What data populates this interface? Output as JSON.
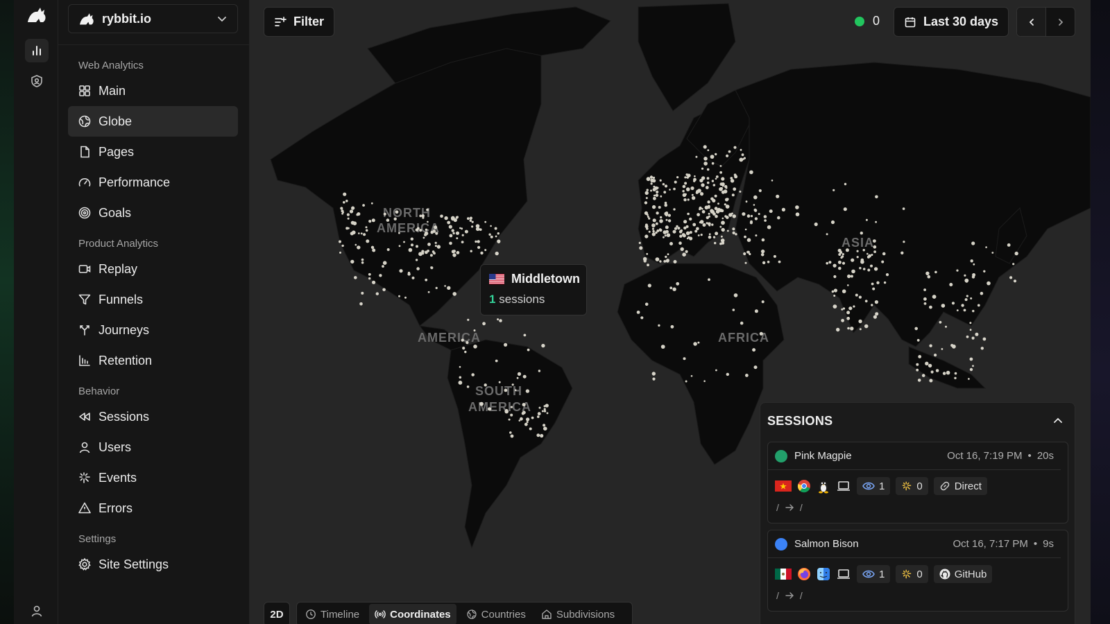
{
  "app": {
    "site_name": "rybbit.io"
  },
  "rail": {
    "icons": [
      "rybbit-logo-icon",
      "analytics-bar-chart-icon",
      "shield-user-icon",
      "user-icon"
    ]
  },
  "sidebar": {
    "sections": [
      {
        "title": "Web Analytics",
        "items": [
          {
            "label": "Main",
            "icon": "layout-grid-icon"
          },
          {
            "label": "Globe",
            "icon": "globe-icon",
            "active": true
          },
          {
            "label": "Pages",
            "icon": "file-icon"
          },
          {
            "label": "Performance",
            "icon": "gauge-icon"
          },
          {
            "label": "Goals",
            "icon": "target-icon"
          }
        ]
      },
      {
        "title": "Product Analytics",
        "items": [
          {
            "label": "Replay",
            "icon": "video-icon"
          },
          {
            "label": "Funnels",
            "icon": "funnel-icon"
          },
          {
            "label": "Journeys",
            "icon": "split-icon"
          },
          {
            "label": "Retention",
            "icon": "bar-chart-icon"
          }
        ]
      },
      {
        "title": "Behavior",
        "items": [
          {
            "label": "Sessions",
            "icon": "rewind-icon"
          },
          {
            "label": "Users",
            "icon": "user-icon"
          },
          {
            "label": "Events",
            "icon": "sparkle-icon"
          },
          {
            "label": "Errors",
            "icon": "warning-icon"
          }
        ]
      },
      {
        "title": "Settings",
        "items": [
          {
            "label": "Site Settings",
            "icon": "gear-icon"
          }
        ]
      }
    ]
  },
  "toolbar": {
    "filter_label": "Filter",
    "live_count": "0",
    "date_range": "Last 30 days"
  },
  "map": {
    "region_labels": [
      "NORTH",
      "AMERICA",
      "AMERICA",
      "SOUTH",
      "AMERICA",
      "AFRICA",
      "ASIA"
    ],
    "tooltip": {
      "city": "Middletown",
      "count": "1",
      "unit": " sessions",
      "flag": "US"
    }
  },
  "bottom_bar": {
    "view_toggle": "2D",
    "tabs": [
      {
        "label": "Timeline",
        "icon": "clock-icon"
      },
      {
        "label": "Coordinates",
        "icon": "radio-icon",
        "active": true
      },
      {
        "label": "Countries",
        "icon": "globe-icon"
      },
      {
        "label": "Subdivisions",
        "icon": "home-icon"
      }
    ]
  },
  "sessions_panel": {
    "title": "SESSIONS",
    "items": [
      {
        "user": "Pink Magpie",
        "time": "Oct 16, 7:19 PM",
        "duration": "20s",
        "avatar_color": "#22a06b",
        "country": "VN",
        "browser": "chrome-icon",
        "os": "linux-icon",
        "device": "laptop-icon",
        "pageviews": "1",
        "events": "0",
        "referrer": "Direct",
        "referrer_icon": "link-icon",
        "path_from": "/",
        "path_to": "/"
      },
      {
        "user": "Salmon Bison",
        "time": "Oct 16, 7:17 PM",
        "duration": "9s",
        "avatar_color": "#3b82f6",
        "country": "MX",
        "browser": "firefox-icon",
        "os": "macos-finder-icon",
        "device": "laptop-icon",
        "pageviews": "1",
        "events": "0",
        "referrer": "GitHub",
        "referrer_icon": "github-icon",
        "path_from": "/",
        "path_to": "/"
      }
    ]
  },
  "colors": {
    "live_dot": "#22c55e",
    "session_count": "#34d399",
    "map_ocean": "#262626",
    "map_land": "#0a0a0a",
    "points": "#e8e4d8"
  }
}
